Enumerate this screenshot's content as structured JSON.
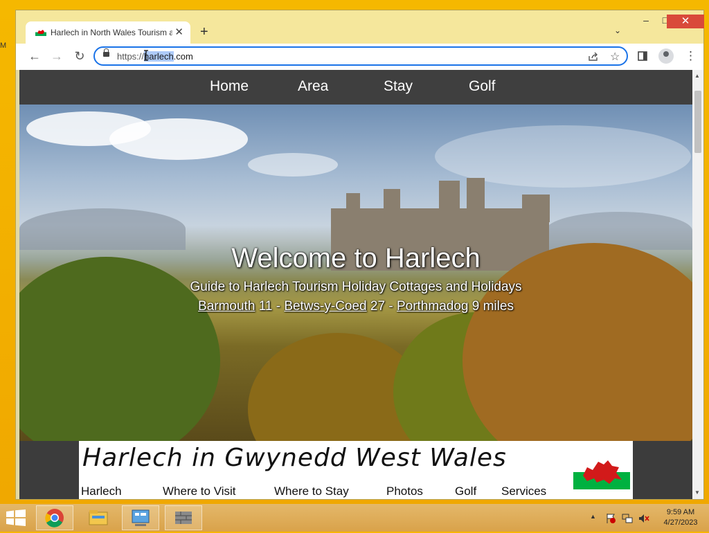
{
  "desktop": {
    "edge_label": "M"
  },
  "browser": {
    "tab": {
      "title": "Harlech in North Wales Tourism a",
      "favicon": "welsh-flag-icon",
      "close_glyph": "✕"
    },
    "new_tab_glyph": "+",
    "tab_list_glyph": "⌄",
    "window_controls": {
      "minimize": "–",
      "maximize": "□",
      "close": "✕"
    },
    "nav": {
      "back": "←",
      "forward": "→",
      "reload": "↻"
    },
    "url": {
      "scheme": "https://",
      "host_selected": "harlech",
      "host_rest": ".com"
    },
    "icons": {
      "share": "share-icon",
      "bookmark": "☆",
      "side_panel": "side-panel-icon",
      "profile": "profile-icon",
      "menu": "⋮"
    }
  },
  "site": {
    "nav": [
      "Home",
      "Area",
      "Stay",
      "Golf"
    ],
    "hero": {
      "title": "Welcome to Harlech",
      "subtitle": "Guide to Harlech Tourism Holiday Cottages and Holidays",
      "distances": [
        {
          "place": "Barmouth",
          "miles": "11"
        },
        {
          "place": "Betws-y-Coed",
          "miles": "27"
        },
        {
          "place": "Porthmadog",
          "miles": "9"
        }
      ],
      "separator": " - ",
      "unit": "miles"
    },
    "panel": {
      "title": "Harlech in Gwynedd West Wales",
      "nav": [
        "Harlech",
        "Where to Visit",
        "Where to Stay",
        "Photos",
        "Golf",
        "Services"
      ]
    }
  },
  "taskbar": {
    "apps": [
      "chrome-icon",
      "file-explorer-icon",
      "control-panel-icon",
      "firewall-icon"
    ],
    "clock": {
      "time": "9:59 AM",
      "date": "4/27/2023"
    },
    "tray": {
      "show_hidden": "▲"
    }
  },
  "colors": {
    "nav_bg": "#3f3f3f",
    "accent_blue": "#1a73e8",
    "title_bar": "#f5e79c",
    "close_red": "#d94a3a"
  }
}
